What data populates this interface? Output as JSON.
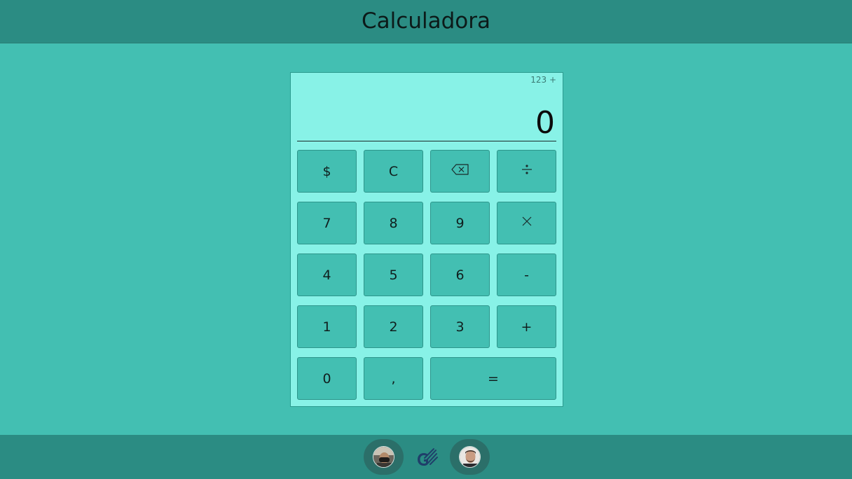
{
  "header": {
    "title": "Calculadora"
  },
  "calculator": {
    "history": "123 +",
    "display": "0",
    "buttons": {
      "currency": "$",
      "clear": "C",
      "backspace_icon": "backspace-icon",
      "divide_icon": "divide-icon",
      "seven": "7",
      "eight": "8",
      "nine": "9",
      "multiply_icon": "multiply-icon",
      "four": "4",
      "five": "5",
      "six": "6",
      "minus": "-",
      "one": "1",
      "two": "2",
      "three": "3",
      "plus": "+",
      "zero": "0",
      "comma": ",",
      "equals": "="
    }
  },
  "footer": {
    "left_avatar": "avatar-icon",
    "logo": "logo-icon",
    "right_avatar": "avatar-icon"
  },
  "colors": {
    "page_bg": "#43bfb2",
    "bar_bg": "#2b8c83",
    "calc_bg": "#88f2e7",
    "button_bg": "#43bfb2"
  }
}
